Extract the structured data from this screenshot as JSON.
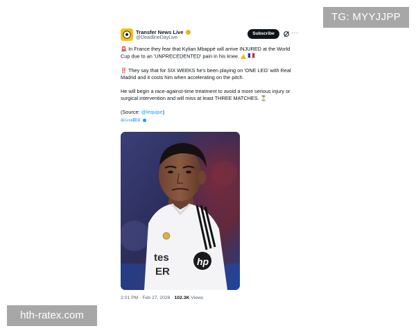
{
  "overlays": {
    "top_right": "TG: MYYJJPP",
    "bottom_left": "hth-ratex.com"
  },
  "tweet": {
    "author_name": "Transfer News Live",
    "author_handle": "@DeadlineDayLive",
    "subscribe_label": "Subscribe",
    "icons": {
      "avatar": "football-avatar-icon",
      "verified": "verified-badge-icon",
      "grok": "grok-icon",
      "more": "more-options-icon",
      "alert": "siren-icon",
      "flag": "france-flag-icon",
      "warning": "warning-icon",
      "hourglass": "hourglass-icon",
      "bang": "double-exclamation-icon"
    },
    "paragraph1": {
      "emoji": "🚨",
      "text": "In France they fear that Kylian Mbappé will arrive INJURED at the World Cup due to an 'UNPRECEDENTED' pain in his knee."
    },
    "paragraph2": {
      "emoji": "‼️",
      "text": "They say that for SIX WEEKS he's been playing on 'ONE LEG' with Real Madrid and it costs him when accelerating on the pitch."
    },
    "paragraph3": {
      "text": "He will begin a race-against-time treatment to avoid a more serious injury or surgical intervention and will miss at least THREE MATCHES.",
      "emoji": "⏳"
    },
    "source": {
      "prefix": "(Source: ",
      "mention": "@lequipe",
      "suffix": ")"
    },
    "translate_label": "由Grok翻译",
    "meta": {
      "time": "2:01 PM",
      "separator1": " · ",
      "date": "Feb 27, 2026",
      "separator2": " · ",
      "views_count": "102.3K",
      "views_label": " Views"
    },
    "photo": {
      "shirt_text": "tes\nER",
      "sponsor": "hp"
    }
  }
}
